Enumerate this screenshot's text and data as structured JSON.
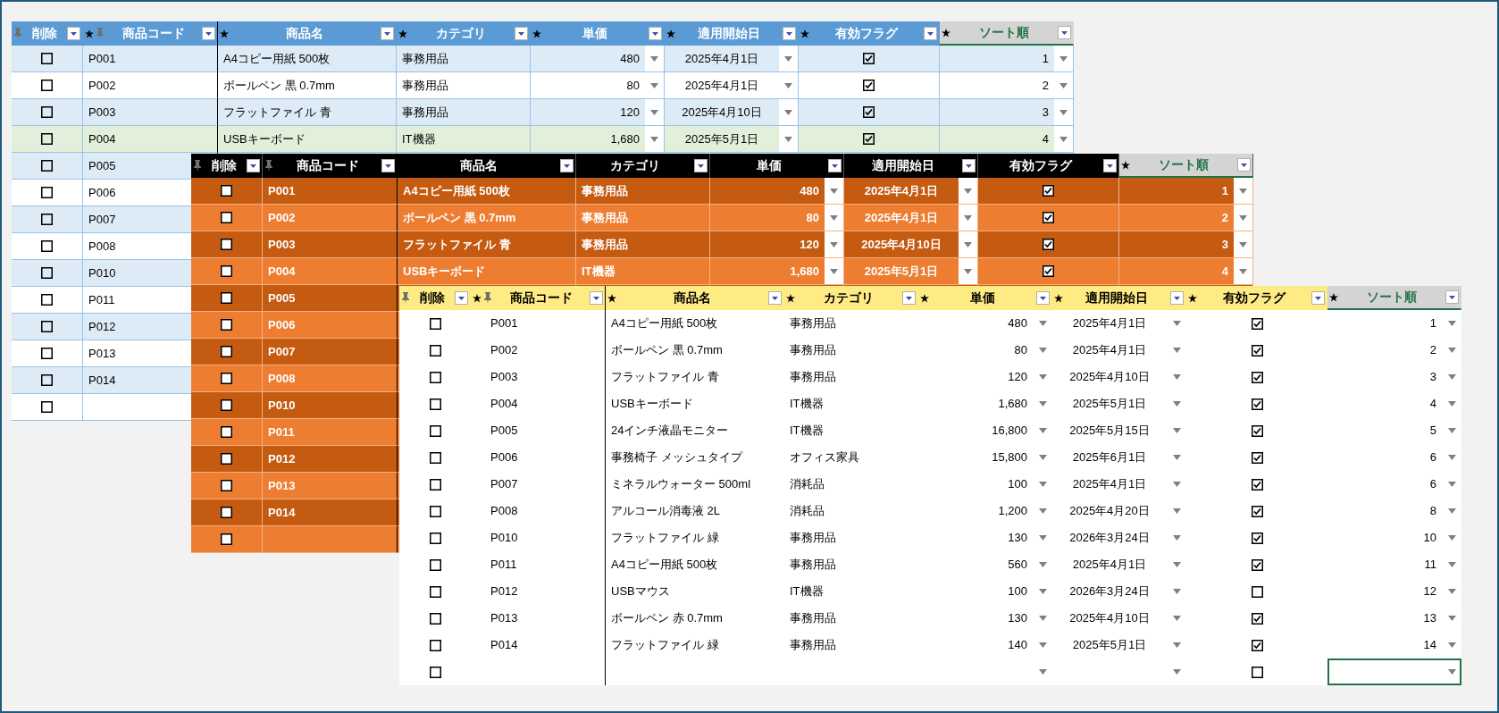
{
  "tables": [
    {
      "columns": [
        {
          "label": "削除",
          "starred": false,
          "pinned": true,
          "selected": false
        },
        {
          "label": "商品コード",
          "starred": true,
          "pinned": true,
          "selected": false
        },
        {
          "label": "商品名",
          "starred": true,
          "pinned": false,
          "selected": false
        },
        {
          "label": "カテゴリ",
          "starred": true,
          "pinned": false,
          "selected": false
        },
        {
          "label": "単価",
          "starred": true,
          "pinned": false,
          "selected": false
        },
        {
          "label": "適用開始日",
          "starred": true,
          "pinned": false,
          "selected": false
        },
        {
          "label": "有効フラグ",
          "starred": true,
          "pinned": false,
          "selected": false
        },
        {
          "label": "ソート順",
          "starred": true,
          "pinned": false,
          "selected": true
        }
      ],
      "rows": [
        {
          "delete": false,
          "code": "P001",
          "name": "A4コピー用紙 500枚",
          "category": "事務用品",
          "price": "480",
          "start_date": "2025年4月1日",
          "active": true,
          "sort": "1",
          "dropdowns": true,
          "highlighted": false
        },
        {
          "delete": false,
          "code": "P002",
          "name": "ボールペン 黒 0.7mm",
          "category": "事務用品",
          "price": "80",
          "start_date": "2025年4月1日",
          "active": true,
          "sort": "2",
          "dropdowns": true,
          "highlighted": false
        },
        {
          "delete": false,
          "code": "P003",
          "name": "フラットファイル 青",
          "category": "事務用品",
          "price": "120",
          "start_date": "2025年4月10日",
          "active": true,
          "sort": "3",
          "dropdowns": true,
          "highlighted": false
        },
        {
          "delete": false,
          "code": "P004",
          "name": "USBキーボード",
          "category": "IT機器",
          "price": "1,680",
          "start_date": "2025年5月1日",
          "active": true,
          "sort": "4",
          "dropdowns": true,
          "highlighted": true
        },
        {
          "delete": false,
          "code": "P005",
          "highlighted": false
        },
        {
          "delete": false,
          "code": "P006",
          "highlighted": false
        },
        {
          "delete": false,
          "code": "P007",
          "highlighted": false
        },
        {
          "delete": false,
          "code": "P008",
          "highlighted": false
        },
        {
          "delete": false,
          "code": "P010",
          "highlighted": false
        },
        {
          "delete": false,
          "code": "P011",
          "highlighted": false
        },
        {
          "delete": false,
          "code": "P012",
          "highlighted": false
        },
        {
          "delete": false,
          "code": "P013",
          "highlighted": false
        },
        {
          "delete": false,
          "code": "P014",
          "highlighted": false
        },
        {
          "delete": false,
          "highlighted": false
        }
      ]
    },
    {
      "columns": [
        {
          "label": "削除",
          "starred": false,
          "pinned": true,
          "selected": false
        },
        {
          "label": "商品コード",
          "starred": false,
          "pinned": true,
          "selected": false
        },
        {
          "label": "商品名",
          "starred": false,
          "pinned": false,
          "selected": false
        },
        {
          "label": "カテゴリ",
          "starred": false,
          "pinned": false,
          "selected": false
        },
        {
          "label": "単価",
          "starred": false,
          "pinned": false,
          "selected": false
        },
        {
          "label": "適用開始日",
          "starred": false,
          "pinned": false,
          "selected": false
        },
        {
          "label": "有効フラグ",
          "starred": false,
          "pinned": false,
          "selected": false
        },
        {
          "label": "ソート順",
          "starred": true,
          "pinned": false,
          "selected": true
        }
      ],
      "rows": [
        {
          "delete": false,
          "code": "P001",
          "name": "A4コピー用紙 500枚",
          "category": "事務用品",
          "price": "480",
          "start_date": "2025年4月1日",
          "active": true,
          "sort": "1",
          "dropdowns": true
        },
        {
          "delete": false,
          "code": "P002",
          "name": "ボールペン 黒 0.7mm",
          "category": "事務用品",
          "price": "80",
          "start_date": "2025年4月1日",
          "active": true,
          "sort": "2",
          "dropdowns": true
        },
        {
          "delete": false,
          "code": "P003",
          "name": "フラットファイル 青",
          "category": "事務用品",
          "price": "120",
          "start_date": "2025年4月10日",
          "active": true,
          "sort": "3",
          "dropdowns": true
        },
        {
          "delete": false,
          "code": "P004",
          "name": "USBキーボード",
          "category": "IT機器",
          "price": "1,680",
          "start_date": "2025年5月1日",
          "active": true,
          "sort": "4",
          "dropdowns": true
        },
        {
          "delete": false,
          "code": "P005"
        },
        {
          "delete": false,
          "code": "P006"
        },
        {
          "delete": false,
          "code": "P007"
        },
        {
          "delete": false,
          "code": "P008"
        },
        {
          "delete": false,
          "code": "P010"
        },
        {
          "delete": false,
          "code": "P011"
        },
        {
          "delete": false,
          "code": "P012"
        },
        {
          "delete": false,
          "code": "P013"
        },
        {
          "delete": false,
          "code": "P014"
        },
        {
          "delete": false
        }
      ]
    },
    {
      "columns": [
        {
          "label": "削除",
          "starred": false,
          "pinned": true,
          "selected": false
        },
        {
          "label": "商品コード",
          "starred": true,
          "pinned": true,
          "selected": false
        },
        {
          "label": "商品名",
          "starred": true,
          "pinned": false,
          "selected": false
        },
        {
          "label": "カテゴリ",
          "starred": true,
          "pinned": false,
          "selected": false
        },
        {
          "label": "単価",
          "starred": true,
          "pinned": false,
          "selected": false
        },
        {
          "label": "適用開始日",
          "starred": true,
          "pinned": false,
          "selected": false
        },
        {
          "label": "有効フラグ",
          "starred": true,
          "pinned": false,
          "selected": false
        },
        {
          "label": "ソート順",
          "starred": true,
          "pinned": false,
          "selected": true
        }
      ],
      "rows": [
        {
          "delete": false,
          "code": "P001",
          "name": "A4コピー用紙 500枚",
          "category": "事務用品",
          "price": "480",
          "start_date": "2025年4月1日",
          "active": true,
          "sort": "1",
          "dropdowns": true
        },
        {
          "delete": false,
          "code": "P002",
          "name": "ボールペン 黒 0.7mm",
          "category": "事務用品",
          "price": "80",
          "start_date": "2025年4月1日",
          "active": true,
          "sort": "2",
          "dropdowns": true
        },
        {
          "delete": false,
          "code": "P003",
          "name": "フラットファイル 青",
          "category": "事務用品",
          "price": "120",
          "start_date": "2025年4月10日",
          "active": true,
          "sort": "3",
          "dropdowns": true
        },
        {
          "delete": false,
          "code": "P004",
          "name": "USBキーボード",
          "category": "IT機器",
          "price": "1,680",
          "start_date": "2025年5月1日",
          "active": true,
          "sort": "4",
          "dropdowns": true
        },
        {
          "delete": false,
          "code": "P005",
          "name": "24インチ液晶モニター",
          "category": "IT機器",
          "price": "16,800",
          "start_date": "2025年5月15日",
          "active": true,
          "sort": "5",
          "dropdowns": true
        },
        {
          "delete": false,
          "code": "P006",
          "name": "事務椅子 メッシュタイプ",
          "category": "オフィス家具",
          "price": "15,800",
          "start_date": "2025年6月1日",
          "active": true,
          "sort": "6",
          "dropdowns": true
        },
        {
          "delete": false,
          "code": "P007",
          "name": "ミネラルウォーター 500ml",
          "category": "消耗品",
          "price": "100",
          "start_date": "2025年4月1日",
          "active": true,
          "sort": "6",
          "dropdowns": true
        },
        {
          "delete": false,
          "code": "P008",
          "name": "アルコール消毒液 2L",
          "category": "消耗品",
          "price": "1,200",
          "start_date": "2025年4月20日",
          "active": true,
          "sort": "8",
          "dropdowns": true
        },
        {
          "delete": false,
          "code": "P010",
          "name": "フラットファイル 緑",
          "category": "事務用品",
          "price": "130",
          "start_date": "2026年3月24日",
          "active": true,
          "sort": "10",
          "dropdowns": true
        },
        {
          "delete": false,
          "code": "P011",
          "name": "A4コピー用紙 500枚",
          "category": "事務用品",
          "price": "560",
          "start_date": "2025年4月1日",
          "active": true,
          "sort": "11",
          "dropdowns": true
        },
        {
          "delete": false,
          "code": "P012",
          "name": "USBマウス",
          "category": "IT機器",
          "price": "100",
          "start_date": "2026年3月24日",
          "active": false,
          "sort": "12",
          "dropdowns": true
        },
        {
          "delete": false,
          "code": "P013",
          "name": "ボールペン 赤 0.7mm",
          "category": "事務用品",
          "price": "130",
          "start_date": "2025年4月10日",
          "active": true,
          "sort": "13",
          "dropdowns": true
        },
        {
          "delete": false,
          "code": "P014",
          "name": "フラットファイル 緑",
          "category": "事務用品",
          "price": "140",
          "start_date": "2025年5月1日",
          "active": true,
          "sort": "14",
          "dropdowns": true
        },
        {
          "delete": false,
          "active": false,
          "dropdowns": true,
          "cursor": true
        }
      ]
    }
  ]
}
